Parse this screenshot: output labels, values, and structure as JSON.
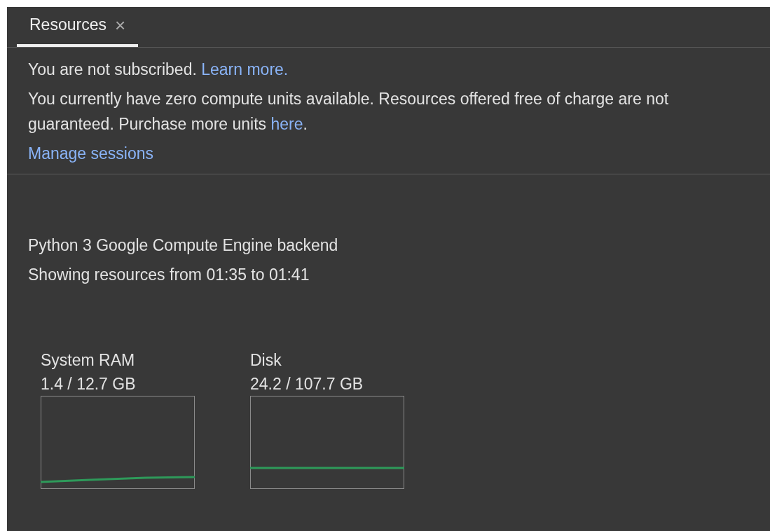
{
  "tabs": [
    {
      "label": "Resources",
      "selected": true,
      "close": "×"
    }
  ],
  "notice": {
    "subscription": "You are not subscribed.",
    "learn_more_link": "Learn more.",
    "compute_units": "You currently have zero compute units available. Resources offered free of charge are not guaranteed. Purchase more units",
    "here_link": "here",
    "compute_units_end": ".",
    "manage_sessions_link": "Manage sessions"
  },
  "backend": {
    "name": "Python 3 Google Compute Engine backend",
    "time_range": "Showing resources from 01:35 to 01:41"
  },
  "meters": [
    {
      "name": "System RAM",
      "usage": "1.4 / 12.7 GB"
    },
    {
      "name": "Disk",
      "usage": "24.2 / 107.7 GB"
    }
  ]
}
